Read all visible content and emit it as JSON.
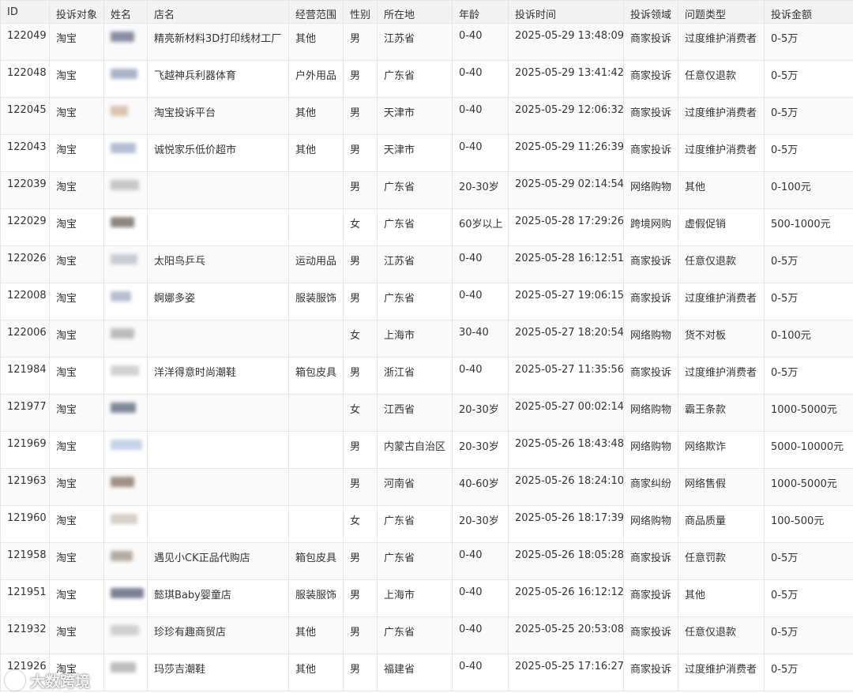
{
  "columns": [
    "ID",
    "投诉对象",
    "姓名",
    "店名",
    "经营范围",
    "性别",
    "所在地",
    "年龄",
    "投诉时间",
    "投诉领域",
    "问题类型",
    "投诉金额"
  ],
  "rows": [
    {
      "id": "122049",
      "target": "淘宝",
      "name_blur": "#8a8fa3",
      "shop": "精亮新材料3D打印线材工厂",
      "scope": "其他",
      "gender": "男",
      "location": "江苏省",
      "age": "0-40",
      "time": "2025-05-29 13:48:09",
      "domain": "商家投诉",
      "issue": "过度维护消费者",
      "amount": "0-5万"
    },
    {
      "id": "122048",
      "target": "淘宝",
      "name_blur": "#a9b6c8",
      "shop": "飞越神兵利器体育",
      "scope": "户外用品",
      "gender": "男",
      "location": "广东省",
      "age": "0-40",
      "time": "2025-05-29 13:41:42",
      "domain": "商家投诉",
      "issue": "任意仅退款",
      "amount": "0-5万"
    },
    {
      "id": "122045",
      "target": "淘宝",
      "name_blur": "#d9c4ae",
      "shop": "淘宝投诉平台",
      "scope": "其他",
      "gender": "男",
      "location": "天津市",
      "age": "0-40",
      "time": "2025-05-29 12:06:32",
      "domain": "商家投诉",
      "issue": "过度维护消费者",
      "amount": "0-5万"
    },
    {
      "id": "122043",
      "target": "淘宝",
      "name_blur": "#b3bfd4",
      "shop": "诚悦家乐低价超市",
      "scope": "其他",
      "gender": "男",
      "location": "天津市",
      "age": "0-40",
      "time": "2025-05-29 11:26:39",
      "domain": "商家投诉",
      "issue": "过度维护消费者",
      "amount": "0-5万"
    },
    {
      "id": "122039",
      "target": "淘宝",
      "name_blur": "#c7c7c7",
      "shop": "",
      "scope": "",
      "gender": "男",
      "location": "广东省",
      "age": "20-30岁",
      "time": "2025-05-29 02:14:54",
      "domain": "网络购物",
      "issue": "其他",
      "amount": "0-100元"
    },
    {
      "id": "122029",
      "target": "淘宝",
      "name_blur": "#8d8580",
      "shop": "",
      "scope": "",
      "gender": "女",
      "location": "广东省",
      "age": "60岁以上",
      "time": "2025-05-28 17:29:26",
      "domain": "跨境网购",
      "issue": "虚假促销",
      "amount": "500-1000元"
    },
    {
      "id": "122026",
      "target": "淘宝",
      "name_blur": "#c9ccd6",
      "shop": "太阳鸟乒乓",
      "scope": "运动用品",
      "gender": "男",
      "location": "江苏省",
      "age": "0-40",
      "time": "2025-05-28 16:12:51",
      "domain": "商家投诉",
      "issue": "任意仅退款",
      "amount": "0-5万"
    },
    {
      "id": "122008",
      "target": "淘宝",
      "name_blur": "#b6bfd0",
      "shop": "婀娜多姿",
      "scope": "服装服饰",
      "gender": "男",
      "location": "广东省",
      "age": "0-40",
      "time": "2025-05-27 19:06:15",
      "domain": "商家投诉",
      "issue": "过度维护消费者",
      "amount": "0-5万"
    },
    {
      "id": "122006",
      "target": "淘宝",
      "name_blur": "#bcbcbc",
      "shop": "",
      "scope": "",
      "gender": "女",
      "location": "上海市",
      "age": "30-40",
      "time": "2025-05-27 18:20:54",
      "domain": "网络购物",
      "issue": "货不对板",
      "amount": "0-100元"
    },
    {
      "id": "121984",
      "target": "淘宝",
      "name_blur": "#d2d2d2",
      "shop": "洋洋得意时尚潮鞋",
      "scope": "箱包皮具",
      "gender": "男",
      "location": "浙江省",
      "age": "0-40",
      "time": "2025-05-27 11:35:56",
      "domain": "商家投诉",
      "issue": "过度维护消费者",
      "amount": "0-5万"
    },
    {
      "id": "121977",
      "target": "淘宝",
      "name_blur": "#7f8a9a",
      "shop": "",
      "scope": "",
      "gender": "女",
      "location": "江西省",
      "age": "20-30岁",
      "time": "2025-05-27 00:02:14",
      "domain": "网络购物",
      "issue": "霸王条款",
      "amount": "1000-5000元"
    },
    {
      "id": "121969",
      "target": "淘宝",
      "name_blur": "#c2d3e8",
      "shop": "",
      "scope": "",
      "gender": "男",
      "location": "内蒙古自治区",
      "age": "20-30岁",
      "time": "2025-05-26 18:43:48",
      "domain": "网络购物",
      "issue": "网络欺诈",
      "amount": "5000-10000元"
    },
    {
      "id": "121963",
      "target": "淘宝",
      "name_blur": "#a08f84",
      "shop": "",
      "scope": "",
      "gender": "男",
      "location": "河南省",
      "age": "40-60岁",
      "time": "2025-05-26 18:24:10",
      "domain": "商家纠纷",
      "issue": "网络售假",
      "amount": "1000-5000元"
    },
    {
      "id": "121960",
      "target": "淘宝",
      "name_blur": "#d7cfc6",
      "shop": "",
      "scope": "",
      "gender": "女",
      "location": "广东省",
      "age": "20-30岁",
      "time": "2025-05-26 18:17:39",
      "domain": "网络购物",
      "issue": "商品质量",
      "amount": "100-500元"
    },
    {
      "id": "121958",
      "target": "淘宝",
      "name_blur": "#b5aba1",
      "shop": "遇见小CK正品代购店",
      "scope": "箱包皮具",
      "gender": "男",
      "location": "广东省",
      "age": "0-40",
      "time": "2025-05-26 18:05:28",
      "domain": "商家投诉",
      "issue": "任意罚款",
      "amount": "0-5万"
    },
    {
      "id": "121951",
      "target": "淘宝",
      "name_blur": "#7b8294",
      "shop": "懿琪Baby婴童店",
      "scope": "服装服饰",
      "gender": "男",
      "location": "上海市",
      "age": "0-40",
      "time": "2025-05-26 16:12:12",
      "domain": "商家投诉",
      "issue": "其他",
      "amount": "0-5万"
    },
    {
      "id": "121932",
      "target": "淘宝",
      "name_blur": "#d0d0d0",
      "shop": "珍珍有趣商贸店",
      "scope": "其他",
      "gender": "男",
      "location": "广东省",
      "age": "0-40",
      "time": "2025-05-25 20:53:08",
      "domain": "商家投诉",
      "issue": "任意仅退款",
      "amount": "0-5万"
    },
    {
      "id": "121926",
      "target": "淘宝",
      "name_blur": "#bdbdbd",
      "shop": "玛莎吉潮鞋",
      "scope": "其他",
      "gender": "男",
      "location": "福建省",
      "age": "0-40",
      "time": "2025-05-25 17:16:27",
      "domain": "商家投诉",
      "issue": "过度维护消费者",
      "amount": "0-5万"
    }
  ],
  "watermark": {
    "text": "大数跨境"
  }
}
